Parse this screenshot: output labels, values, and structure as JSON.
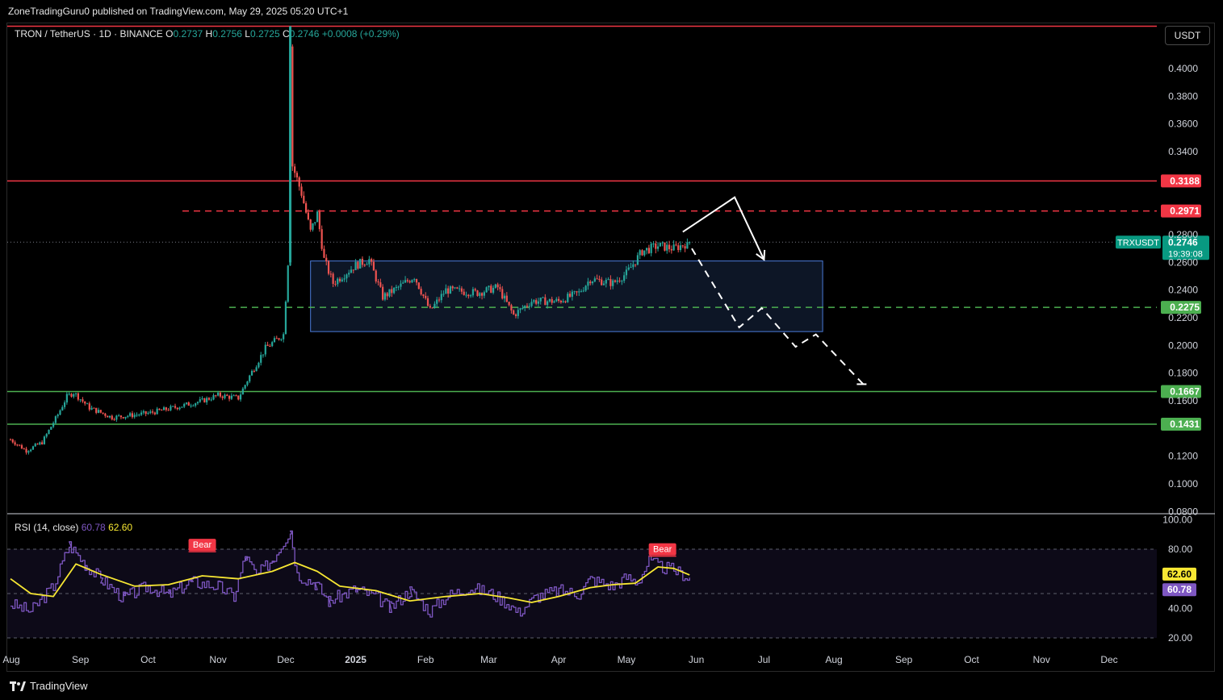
{
  "attribution": "ZoneTradingGuru0 published on TradingView.com, May 29, 2025 05:20 UTC+1",
  "currency_button": "USDT",
  "footer_logo": "TradingView",
  "legend": {
    "symbol": "TRON / TetherUS · 1D · BINANCE",
    "o_label": "O",
    "o": "0.2737",
    "h_label": "H",
    "h": "0.2756",
    "l_label": "L",
    "l": "0.2725",
    "c_label": "C",
    "c": "0.2746",
    "change": "+0.0008 (+0.29%)"
  },
  "price_tag": {
    "symbol": "TRXUSDT",
    "price": "0.2746",
    "countdown": "19:39:08"
  },
  "rsi_legend": {
    "name": "RSI (14, close)",
    "rsi": "60.78",
    "ma": "62.60"
  },
  "colors": {
    "up": "#26a69a",
    "down": "#ef5350",
    "red_line": "#f23645",
    "green_line": "#4caf50",
    "rsi": "#7e57c2",
    "rsi_ma": "#f7e733",
    "box_border": "#4a7ad8",
    "box_fill": "#0d1626"
  },
  "chart_data": [
    {
      "type": "candlestick",
      "title": "TRON / TetherUS · 1D · BINANCE",
      "y_axis_ticks": [
        "0.4000",
        "0.3800",
        "0.3600",
        "0.3400",
        "0.2800",
        "0.2600",
        "0.2400",
        "0.2200",
        "0.2000",
        "0.1800",
        "0.1600",
        "0.1200",
        "0.1000",
        "0.0800"
      ],
      "x_axis_ticks": [
        "Aug",
        "Sep",
        "Oct",
        "Nov",
        "Dec",
        "2025",
        "Feb",
        "Mar",
        "Apr",
        "May",
        "Jun",
        "Jul",
        "Aug",
        "Sep",
        "Oct",
        "Nov",
        "Dec"
      ],
      "ylim": [
        0.08,
        0.43
      ],
      "close_path": [
        {
          "date": "2024-08-01",
          "close": 0.132
        },
        {
          "date": "2024-08-08",
          "close": 0.124
        },
        {
          "date": "2024-08-15",
          "close": 0.13
        },
        {
          "date": "2024-08-22",
          "close": 0.15
        },
        {
          "date": "2024-08-26",
          "close": 0.163
        },
        {
          "date": "2024-08-29",
          "close": 0.166
        },
        {
          "date": "2024-09-05",
          "close": 0.155
        },
        {
          "date": "2024-09-15",
          "close": 0.148
        },
        {
          "date": "2024-10-01",
          "close": 0.151
        },
        {
          "date": "2024-10-15",
          "close": 0.156
        },
        {
          "date": "2024-10-25",
          "close": 0.16
        },
        {
          "date": "2024-11-01",
          "close": 0.164
        },
        {
          "date": "2024-11-10",
          "close": 0.162
        },
        {
          "date": "2024-11-15",
          "close": 0.178
        },
        {
          "date": "2024-11-22",
          "close": 0.198
        },
        {
          "date": "2024-11-30",
          "close": 0.208
        },
        {
          "date": "2024-12-02",
          "close": 0.26
        },
        {
          "date": "2024-12-03",
          "close": 0.42
        },
        {
          "date": "2024-12-04",
          "close": 0.33
        },
        {
          "date": "2024-12-08",
          "close": 0.31
        },
        {
          "date": "2024-12-12",
          "close": 0.282
        },
        {
          "date": "2024-12-15",
          "close": 0.295
        },
        {
          "date": "2024-12-18",
          "close": 0.262
        },
        {
          "date": "2024-12-22",
          "close": 0.245
        },
        {
          "date": "2025-01-01",
          "close": 0.258
        },
        {
          "date": "2025-01-07",
          "close": 0.262
        },
        {
          "date": "2025-01-13",
          "close": 0.235
        },
        {
          "date": "2025-01-20",
          "close": 0.242
        },
        {
          "date": "2025-01-27",
          "close": 0.25
        },
        {
          "date": "2025-02-03",
          "close": 0.225
        },
        {
          "date": "2025-02-10",
          "close": 0.24
        },
        {
          "date": "2025-02-24",
          "close": 0.238
        },
        {
          "date": "2025-03-05",
          "close": 0.242
        },
        {
          "date": "2025-03-12",
          "close": 0.222
        },
        {
          "date": "2025-03-20",
          "close": 0.232
        },
        {
          "date": "2025-04-01",
          "close": 0.232
        },
        {
          "date": "2025-04-10",
          "close": 0.238
        },
        {
          "date": "2025-04-15",
          "close": 0.248
        },
        {
          "date": "2025-04-25",
          "close": 0.245
        },
        {
          "date": "2025-05-01",
          "close": 0.252
        },
        {
          "date": "2025-05-08",
          "close": 0.268
        },
        {
          "date": "2025-05-15",
          "close": 0.272
        },
        {
          "date": "2025-05-22",
          "close": 0.27
        },
        {
          "date": "2025-05-29",
          "close": 0.2746
        }
      ],
      "horizontal_levels": [
        {
          "price": 0.3188,
          "label": "0.3188",
          "color": "red",
          "style": "solid"
        },
        {
          "price": 0.2971,
          "label": "0.2971",
          "color": "red",
          "style": "dashed"
        },
        {
          "price": 0.2275,
          "label": "0.2275",
          "color": "green",
          "style": "dashed"
        },
        {
          "price": 0.1667,
          "label": "0.1667",
          "color": "green",
          "style": "solid"
        },
        {
          "price": 0.1431,
          "label": "0.1431",
          "color": "green",
          "style": "solid"
        },
        {
          "price": 0.4306,
          "color": "red",
          "style": "solid"
        }
      ],
      "range_box": {
        "from": "2024-12-12",
        "to": "2025-07-27",
        "top": 0.261,
        "bottom": 0.21
      },
      "annotation_paths": [
        {
          "style": "solid",
          "points": [
            [
              "2025-05-26",
              0.282
            ],
            [
              "2025-06-18",
              0.307
            ],
            [
              "2025-07-01",
              0.262
            ]
          ]
        },
        {
          "style": "dashed",
          "points": [
            [
              "2025-05-30",
              0.27
            ],
            [
              "2025-06-20",
              0.213
            ],
            [
              "2025-06-30",
              0.227
            ],
            [
              "2025-07-15",
              0.199
            ],
            [
              "2025-07-24",
              0.208
            ],
            [
              "2025-08-14",
              0.172
            ]
          ]
        }
      ],
      "current_price": 0.2746
    },
    {
      "type": "line",
      "title": "RSI (14, close)",
      "y_axis_ticks": [
        "100.00",
        "80.00",
        "40.00",
        "20.00"
      ],
      "ylim": [
        12,
        100
      ],
      "bands": [
        80,
        50,
        20
      ],
      "series": [
        {
          "name": "RSI",
          "color": "#7e57c2",
          "current": 60.78,
          "points": [
            [
              "2024-08-01",
              43
            ],
            [
              "2024-08-10",
              38
            ],
            [
              "2024-08-20",
              55
            ],
            [
              "2024-08-27",
              83
            ],
            [
              "2024-09-03",
              70
            ],
            [
              "2024-09-10",
              60
            ],
            [
              "2024-09-20",
              47
            ],
            [
              "2024-10-01",
              55
            ],
            [
              "2024-10-10",
              49
            ],
            [
              "2024-10-20",
              58
            ],
            [
              "2024-11-01",
              55
            ],
            [
              "2024-11-08",
              48
            ],
            [
              "2024-11-13",
              75
            ],
            [
              "2024-11-18",
              62
            ],
            [
              "2024-11-25",
              73
            ],
            [
              "2024-12-03",
              93
            ],
            [
              "2024-12-06",
              63
            ],
            [
              "2024-12-14",
              57
            ],
            [
              "2024-12-20",
              45
            ],
            [
              "2025-01-01",
              53
            ],
            [
              "2025-01-10",
              48
            ],
            [
              "2025-01-16",
              40
            ],
            [
              "2025-01-25",
              52
            ],
            [
              "2025-02-03",
              38
            ],
            [
              "2025-02-10",
              48
            ],
            [
              "2025-02-20",
              54
            ],
            [
              "2025-03-01",
              51
            ],
            [
              "2025-03-10",
              43
            ],
            [
              "2025-03-14",
              37
            ],
            [
              "2025-03-22",
              48
            ],
            [
              "2025-04-01",
              52
            ],
            [
              "2025-04-10",
              50
            ],
            [
              "2025-04-15",
              60
            ],
            [
              "2025-04-25",
              55
            ],
            [
              "2025-05-01",
              61
            ],
            [
              "2025-05-06",
              58
            ],
            [
              "2025-05-11",
              72
            ],
            [
              "2025-05-16",
              68
            ],
            [
              "2025-05-22",
              66
            ],
            [
              "2025-05-29",
              60.78
            ]
          ]
        },
        {
          "name": "RSI-based MA",
          "color": "#f7e733",
          "current": 62.6,
          "points": [
            [
              "2024-08-01",
              60
            ],
            [
              "2024-08-10",
              50
            ],
            [
              "2024-08-20",
              48
            ],
            [
              "2024-08-30",
              70
            ],
            [
              "2024-09-10",
              63
            ],
            [
              "2024-09-25",
              55
            ],
            [
              "2024-10-10",
              56
            ],
            [
              "2024-10-25",
              62
            ],
            [
              "2024-11-10",
              60
            ],
            [
              "2024-11-25",
              65
            ],
            [
              "2024-12-05",
              71
            ],
            [
              "2024-12-15",
              65
            ],
            [
              "2024-12-25",
              55
            ],
            [
              "2025-01-10",
              52
            ],
            [
              "2025-01-25",
              45
            ],
            [
              "2025-02-10",
              48
            ],
            [
              "2025-02-25",
              50
            ],
            [
              "2025-03-10",
              47
            ],
            [
              "2025-03-20",
              44
            ],
            [
              "2025-04-01",
              48
            ],
            [
              "2025-04-15",
              54
            ],
            [
              "2025-04-25",
              56
            ],
            [
              "2025-05-05",
              57
            ],
            [
              "2025-05-15",
              68
            ],
            [
              "2025-05-22",
              67
            ],
            [
              "2025-05-29",
              62.6
            ]
          ]
        }
      ],
      "signals": [
        {
          "label": "Bear",
          "date": "2024-10-25",
          "value": 75
        },
        {
          "label": "Bear",
          "date": "2025-05-17",
          "value": 72
        }
      ]
    }
  ]
}
